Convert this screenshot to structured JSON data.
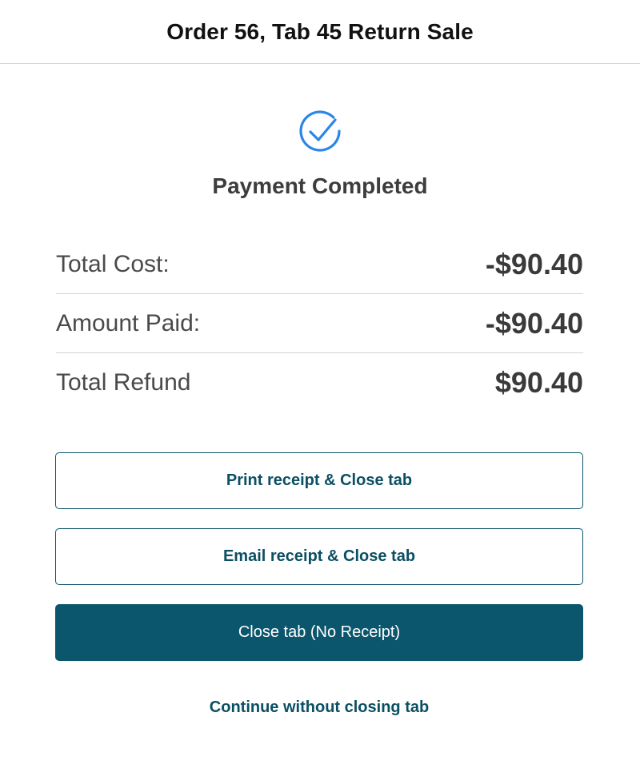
{
  "header": {
    "title": "Order 56, Tab 45 Return Sale"
  },
  "status": {
    "icon": "check-circle-icon",
    "icon_color": "#2b86e8",
    "text": "Payment Completed"
  },
  "summary": {
    "rows": [
      {
        "label": "Total Cost:",
        "value": "-$90.40"
      },
      {
        "label": "Amount Paid:",
        "value": "-$90.40"
      },
      {
        "label": "Total Refund",
        "value": "$90.40"
      }
    ]
  },
  "actions": {
    "print_label": "Print receipt & Close tab",
    "email_label": "Email receipt & Close tab",
    "close_label": "Close tab (No Receipt)",
    "continue_label": "Continue without closing tab"
  },
  "colors": {
    "accent": "#0b566d",
    "text": "#3a3a3a",
    "divider": "#d3d3d3"
  }
}
